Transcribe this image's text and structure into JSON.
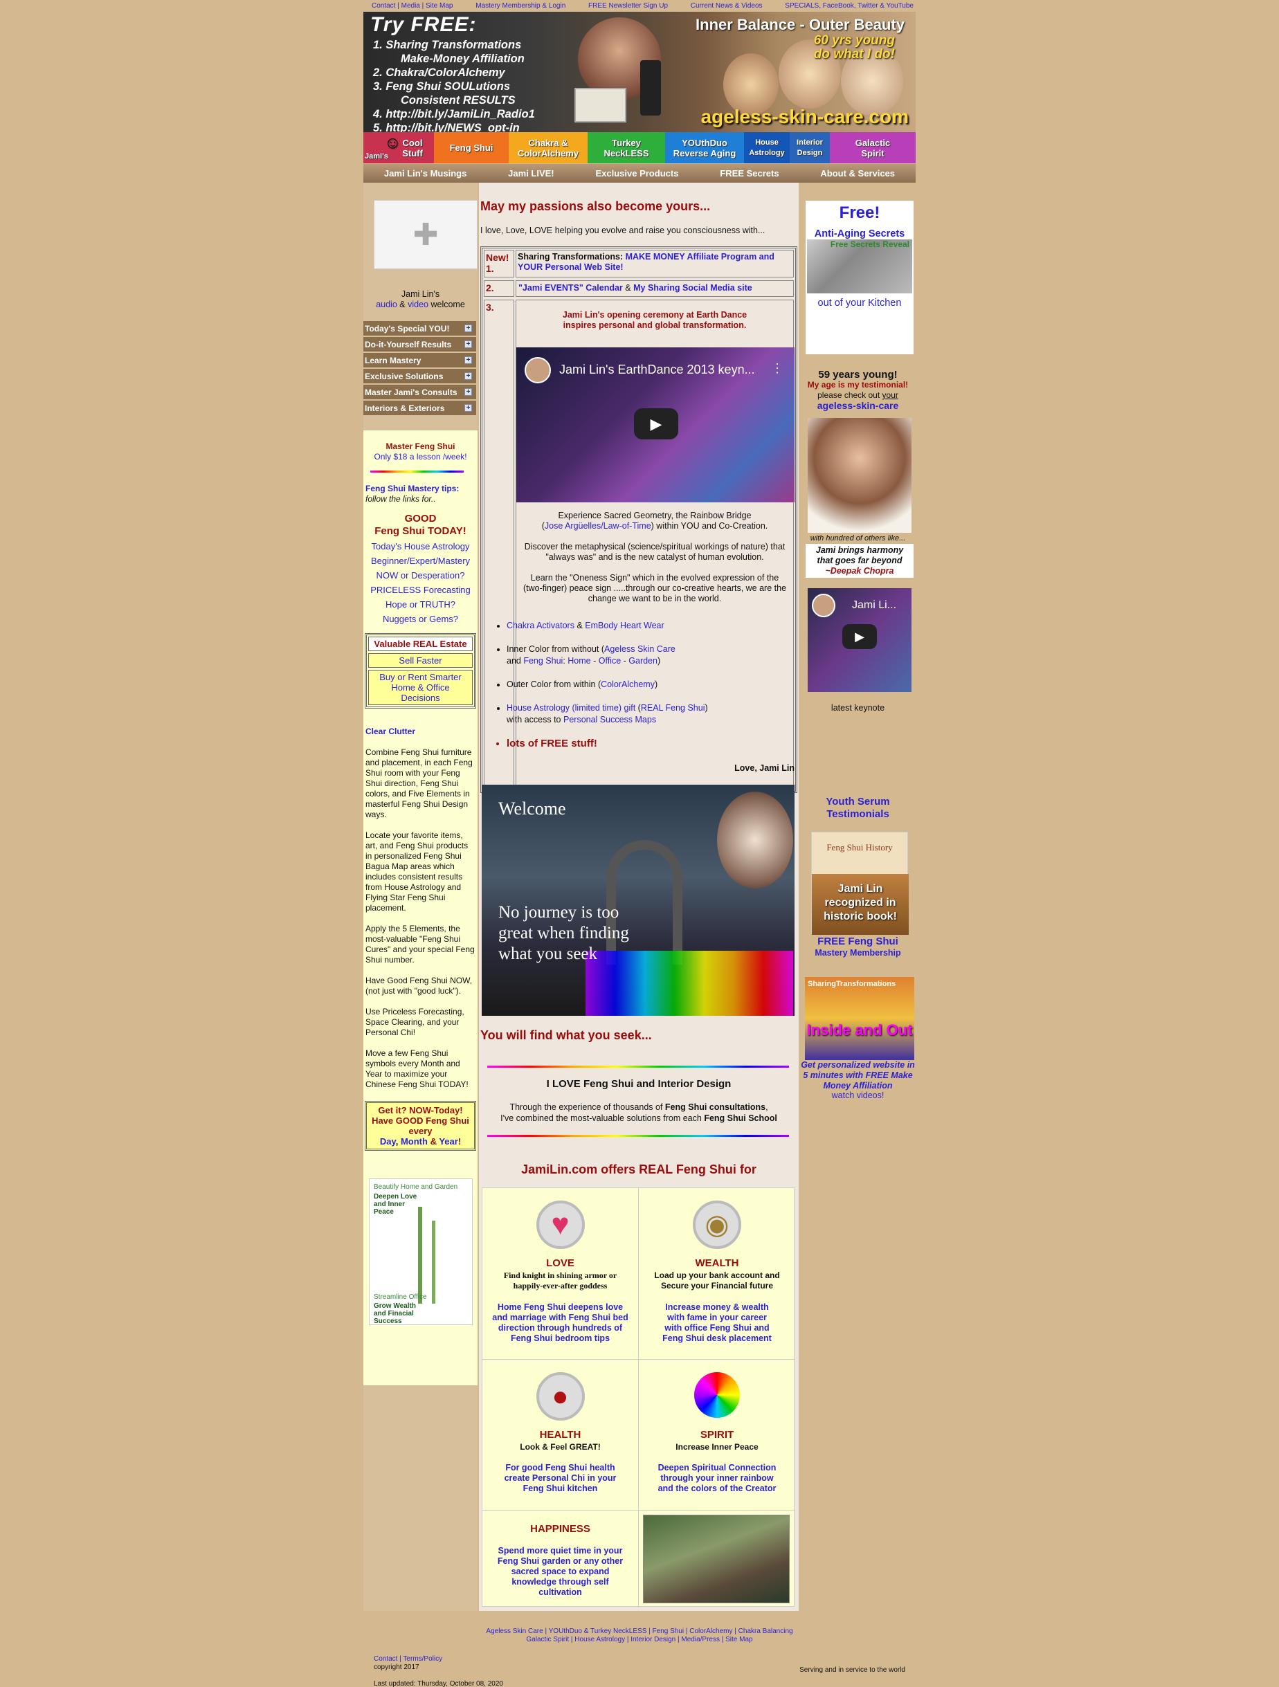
{
  "topbar": {
    "links": [
      "Contact | Media | Site Map",
      "Mastery Membership & Login",
      "FREE Newsletter Sign Up",
      "Current News & Videos",
      "SPECIALS, FaceBook, Twitter & YouTube"
    ]
  },
  "banner": {
    "try": "Try FREE:",
    "items": [
      "1. Sharing Transformations",
      "Make-Money Affiliation",
      "2. Chakra/ColorAlchemy",
      "3. Feng Shui SOULutions",
      "Consistent RESULTS",
      "4. http://bit.ly/JamiLin_Radio1",
      "5. http://bit.ly/NEWS_opt-in"
    ],
    "headline": "Inner Balance - Outer Beauty",
    "young": "60 yrs young",
    "young2": "do what I do!",
    "site": "ageless-skin-care.com"
  },
  "nav_color": [
    {
      "label": "Cool Stuff",
      "pre": "Jami's",
      "color": "#c8324e"
    },
    {
      "label": "Feng Shui",
      "color": "#f0721e"
    },
    {
      "label": "Chakra & ColorAlchemy",
      "color": "#f4a81e"
    },
    {
      "label": "Turkey NeckLESS",
      "color": "#2eae3a"
    },
    {
      "label": "YOUthDuo Reverse Aging",
      "color": "#1f7fd6"
    },
    {
      "label": "House Astrology",
      "color": "#1456b8"
    },
    {
      "label": "Interior Design",
      "color": "#2a64b8"
    },
    {
      "label": "Galactic Spirit",
      "color": "#b83fb8"
    }
  ],
  "nav_gray": [
    "Jami Lin's Musings",
    "Jami LIVE!",
    "Exclusive Products",
    "FREE Secrets",
    "About & Services"
  ],
  "left": {
    "welcome1": "Jami Lin's",
    "audio": "audio",
    "amp": "&",
    "video": "video",
    "welcome2": "welcome",
    "menu": [
      "Today's Special YOU!",
      "Do-it-Yourself Results",
      "Learn Mastery",
      "Exclusive Solutions",
      "Master Jami's Consults",
      "Interiors & Exteriors"
    ],
    "master": "Master Feng Shui",
    "price": "Only $18 a lesson /week!",
    "tips": "Feng Shui Mastery tips:",
    "follow": "follow the links for..",
    "good1": "GOOD",
    "good2": "Feng Shui TODAY!",
    "links": [
      "Today's House Astrology",
      "Beginner/Expert/Mastery",
      "NOW or Desperation?",
      "PRICELESS Forecasting",
      "Hope or TRUTH?",
      "Nuggets or Gems?"
    ],
    "realestate": "Valuable REAL Estate",
    "sell": "Sell Faster",
    "buy": "Buy or Rent Smarter Home & Office Decisions",
    "clutter": "Clear Clutter",
    "p1": "Combine Feng Shui furniture and placement, in each Feng Shui room with your Feng Shui direction, Feng Shui colors, and Five Elements in masterful Feng Shui Design ways.",
    "p2": "Locate your favorite items, art, and Feng Shui products in personalized Feng Shui Bagua Map areas which includes consistent results from House Astrology and Flying Star Feng Shui placement.",
    "p3": "Apply the 5 Elements, the most-valuable \"Feng Shui Cures\" and your special Feng Shui number.",
    "p4": "Have Good Feng Shui NOW, (not just with \"good luck\").",
    "p5": "Use Priceless Forecasting, Space Clearing, and your Personal Chi!",
    "p6": "Move a few Feng Shui symbols every Month and Year to maximize your Chinese Feng Shui TODAY!",
    "getit": "Get it? NOW-Today!",
    "havegood": "Have GOOD Feng Shui every",
    "day": "Day",
    "month": "Month",
    "year": "Year",
    "img_t1": "Beautify Home and Garden",
    "img_t2": "Deepen Love and Inner Peace",
    "img_t3": "Streamline Office",
    "img_t4": "Grow Wealth and Finacial Success"
  },
  "main": {
    "title": "May my passions also become yours...",
    "intro": "I love, Love, LOVE helping you evolve and raise you consciousness with...",
    "new": "New!",
    "n1": "1.",
    "row1a": "Sharing Transformations:",
    "row1b": "MAKE MONEY Affiliate Program and YOUR Personal Web Site!",
    "n2": "2.",
    "row2a": "\"Jami EVENTS\" Calendar",
    "row2amp": "&",
    "row2b": "My Sharing Social Media site",
    "n3": "3.",
    "row3head": "Jami Lin's opening ceremony at Earth Dance inspires personal and global transformation.",
    "video_title": "Jami Lin's EarthDance 2013 keyn...",
    "sg1": "Experience Sacred Geometry, the Rainbow Bridge",
    "sg2a": "(",
    "sg2link": "Jose Argüelles/Law-of-Time",
    "sg2b": ") within YOU and Co-Creation.",
    "sg3": "Discover the metaphysical (science/spiritual workings of nature) that \"always was\" and is the new catalyst of human evolution.",
    "sg4": "Learn the \"Oneness Sign\" which in the evolved expression of the (two-finger) peace sign .....through our co-creative hearts, we are the change we want to be in the world.",
    "b1a": "Chakra Activators",
    "b1amp": "&",
    "b1b": "EmBody Heart Wear",
    "b2a": "Inner Color from without (",
    "b2link": "Ageless Skin Care",
    "b2b": "and",
    "b2c": "Feng Shui",
    "b2d": "Home",
    "b2e": "Office",
    "b2f": "Garden",
    "b3a": "Outer Color from within (",
    "b3link": "ColorAlchemy",
    "b4a": "House Astrology (limited time) gift",
    "b4b": "REAL Feng Shui",
    "b4c": "with access to",
    "b4d": "Personal Success Maps",
    "b5": "lots of FREE stuff!",
    "love": "Love, Jami Lin",
    "welcome": "Welcome",
    "quote": "No journey is too great when finding what you seek",
    "find": "You will find what you seek...",
    "ilove": "I LOVE Feng Shui and Interior Design",
    "exp1": "Through the experience of thousands of",
    "exp1b": "Feng Shui consultations",
    "exp2": "I've combined the most-valuable solutions from each",
    "exp2b": "Feng Shui School",
    "offers": "JamiLin.com offers REAL Feng Shui for",
    "grid": [
      {
        "title": "LOVE",
        "sub": "Find knight in shining armor or happily-ever-after goddess",
        "text": "Home Feng Shui deepens love and marriage with Feng Shui bed direction through hundreds of Feng Shui bedroom tips"
      },
      {
        "title": "WEALTH",
        "sub": "Load up your bank account and Secure your Financial future",
        "text": "Increase money & wealth with fame in your career with office Feng Shui and Feng Shui desk placement"
      },
      {
        "title": "HEALTH",
        "sub": "Look & Feel GREAT!",
        "text": "For good Feng Shui health create Personal Chi in your Feng Shui kitchen"
      },
      {
        "title": "SPIRIT",
        "sub": "Increase Inner Peace",
        "text": "Deepen Spiritual Connection through your inner rainbow and the colors of the Creator"
      },
      {
        "title": "HAPPINESS",
        "sub": "",
        "text": "Spend more quiet time in your Feng Shui garden or any other sacred space to expand knowledge through self cultivation"
      }
    ]
  },
  "right": {
    "free": "Free!",
    "anti": "Anti-Aging Secrets",
    "reveal": "Free Secrets Reveal",
    "kitchen": "out of your Kitchen",
    "young": "59 years young!",
    "testimonial": "My age is my testimonial!",
    "check": "please check out",
    "your": "your",
    "agl": "ageless-skin-care",
    "withh": "with hundred of others like...",
    "harmony": "Jami brings harmony that goes far beyond",
    "deepak": "~Deepak Chopra",
    "vid": "Jami Li...",
    "keynote": "latest keynote",
    "youth": "Youth Serum Testimonials",
    "hist": "Feng Shui History",
    "recog": "Jami Lin recognized in historic book!",
    "fm": "FREE Feng Shui",
    "mm": "Mastery Membership",
    "st": "SharingTransformations",
    "inside": "Inside and Out",
    "personalized": "Get personalized website in 5 minutes with FREE Make Money Affiliation",
    "watch": "watch videos!"
  },
  "footer": {
    "l1": "Ageless Skin Care | YOUthDuo & Turkey NeckLESS | Feng Shui | ColorAlchemy | Chakra Balancing",
    "l2": "Galactic Spirit | House Astrology | Interior Design | Media/Press | Site Map",
    "contact": "Contact | Terms/Policy",
    "copy": "copyright 2017",
    "updated": "Last updated: Thursday, October 08, 2020",
    "serving": "Serving and in service to the world"
  },
  "colors": {
    "bg": "#d4b990",
    "link": "#2a1fd6",
    "red": "#9a0c0c"
  }
}
